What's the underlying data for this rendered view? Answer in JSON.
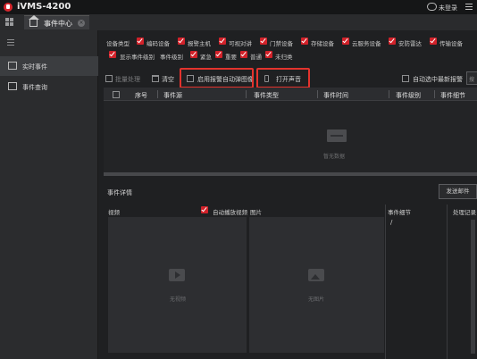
{
  "app": {
    "title": "iVMS-4200",
    "login_label": "未登录"
  },
  "tabs": [
    {
      "label": "事件中心",
      "active": true
    }
  ],
  "sidebar": {
    "items": [
      {
        "label": "实时事件",
        "active": true
      },
      {
        "label": "事件查询",
        "active": false
      }
    ]
  },
  "filters": {
    "device_type_label": "设备类型",
    "device_types": [
      "编码设备",
      "报警主机",
      "可视对讲",
      "门禁设备",
      "存储设备",
      "云服务设备",
      "安防雷达",
      "传输设备"
    ],
    "show_level_label": "显示事件级别",
    "level_label": "事件级别",
    "levels": [
      "紧急",
      "重要",
      "普通",
      "未归类"
    ]
  },
  "toolbar": {
    "batch_process_label": "批量处理",
    "clear_label": "清空",
    "auto_popup_label": "启用报警自动弹图像",
    "open_sound_label": "打开声音",
    "latest_alarm_label": "自动选中最新报警",
    "search_fragment": "搜"
  },
  "table": {
    "columns": [
      "序号",
      "事件源",
      "事件类型",
      "事件时间",
      "事件级别",
      "事件细节"
    ],
    "rows": [],
    "empty_label": "暂无数据"
  },
  "details": {
    "title": "事件详情",
    "send_mail_label": "发送邮件",
    "video_label": "视频",
    "auto_play_label": "自动播放视频",
    "picture_label": "图片",
    "detail_label": "事件细节",
    "record_label": "处理记录",
    "no_video_label": "无视频",
    "no_picture_label": "无图片",
    "detail_value": "/"
  },
  "colors": {
    "accent": "#d2222a",
    "highlight_box": "#e3332d",
    "background": "#1f2022"
  },
  "icons": [
    "app-logo-icon",
    "cloud-icon",
    "menu-icon",
    "grid-icon",
    "home-icon",
    "close-icon",
    "hamburger-icon",
    "monitor-icon",
    "list-icon",
    "trash-icon",
    "image-icon",
    "speaker-icon",
    "empty-box-icon",
    "play-icon",
    "picture-icon"
  ]
}
